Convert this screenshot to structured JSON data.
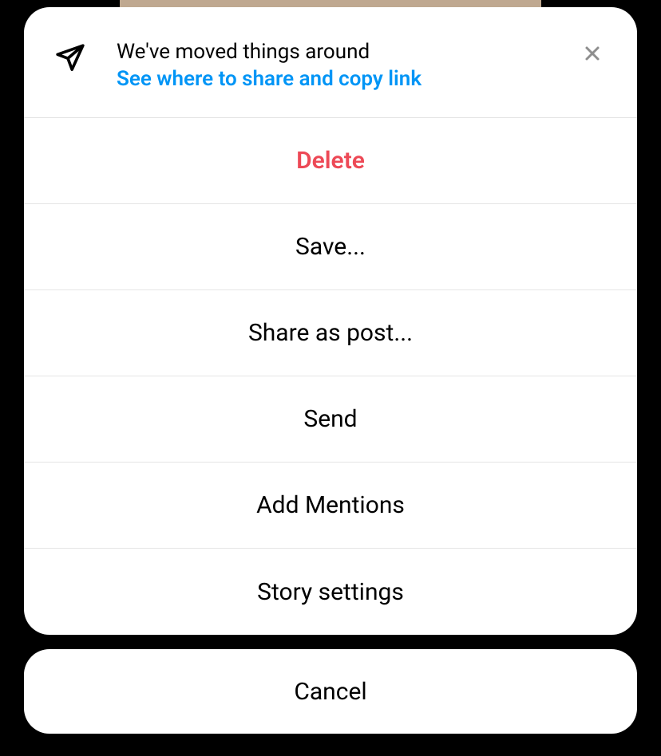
{
  "header": {
    "title": "We've moved things around",
    "link": "See where to share and copy link"
  },
  "options": {
    "delete": "Delete",
    "save": "Save...",
    "share_as_post": "Share as post...",
    "send": "Send",
    "add_mentions": "Add Mentions",
    "story_settings": "Story settings"
  },
  "cancel": "Cancel"
}
